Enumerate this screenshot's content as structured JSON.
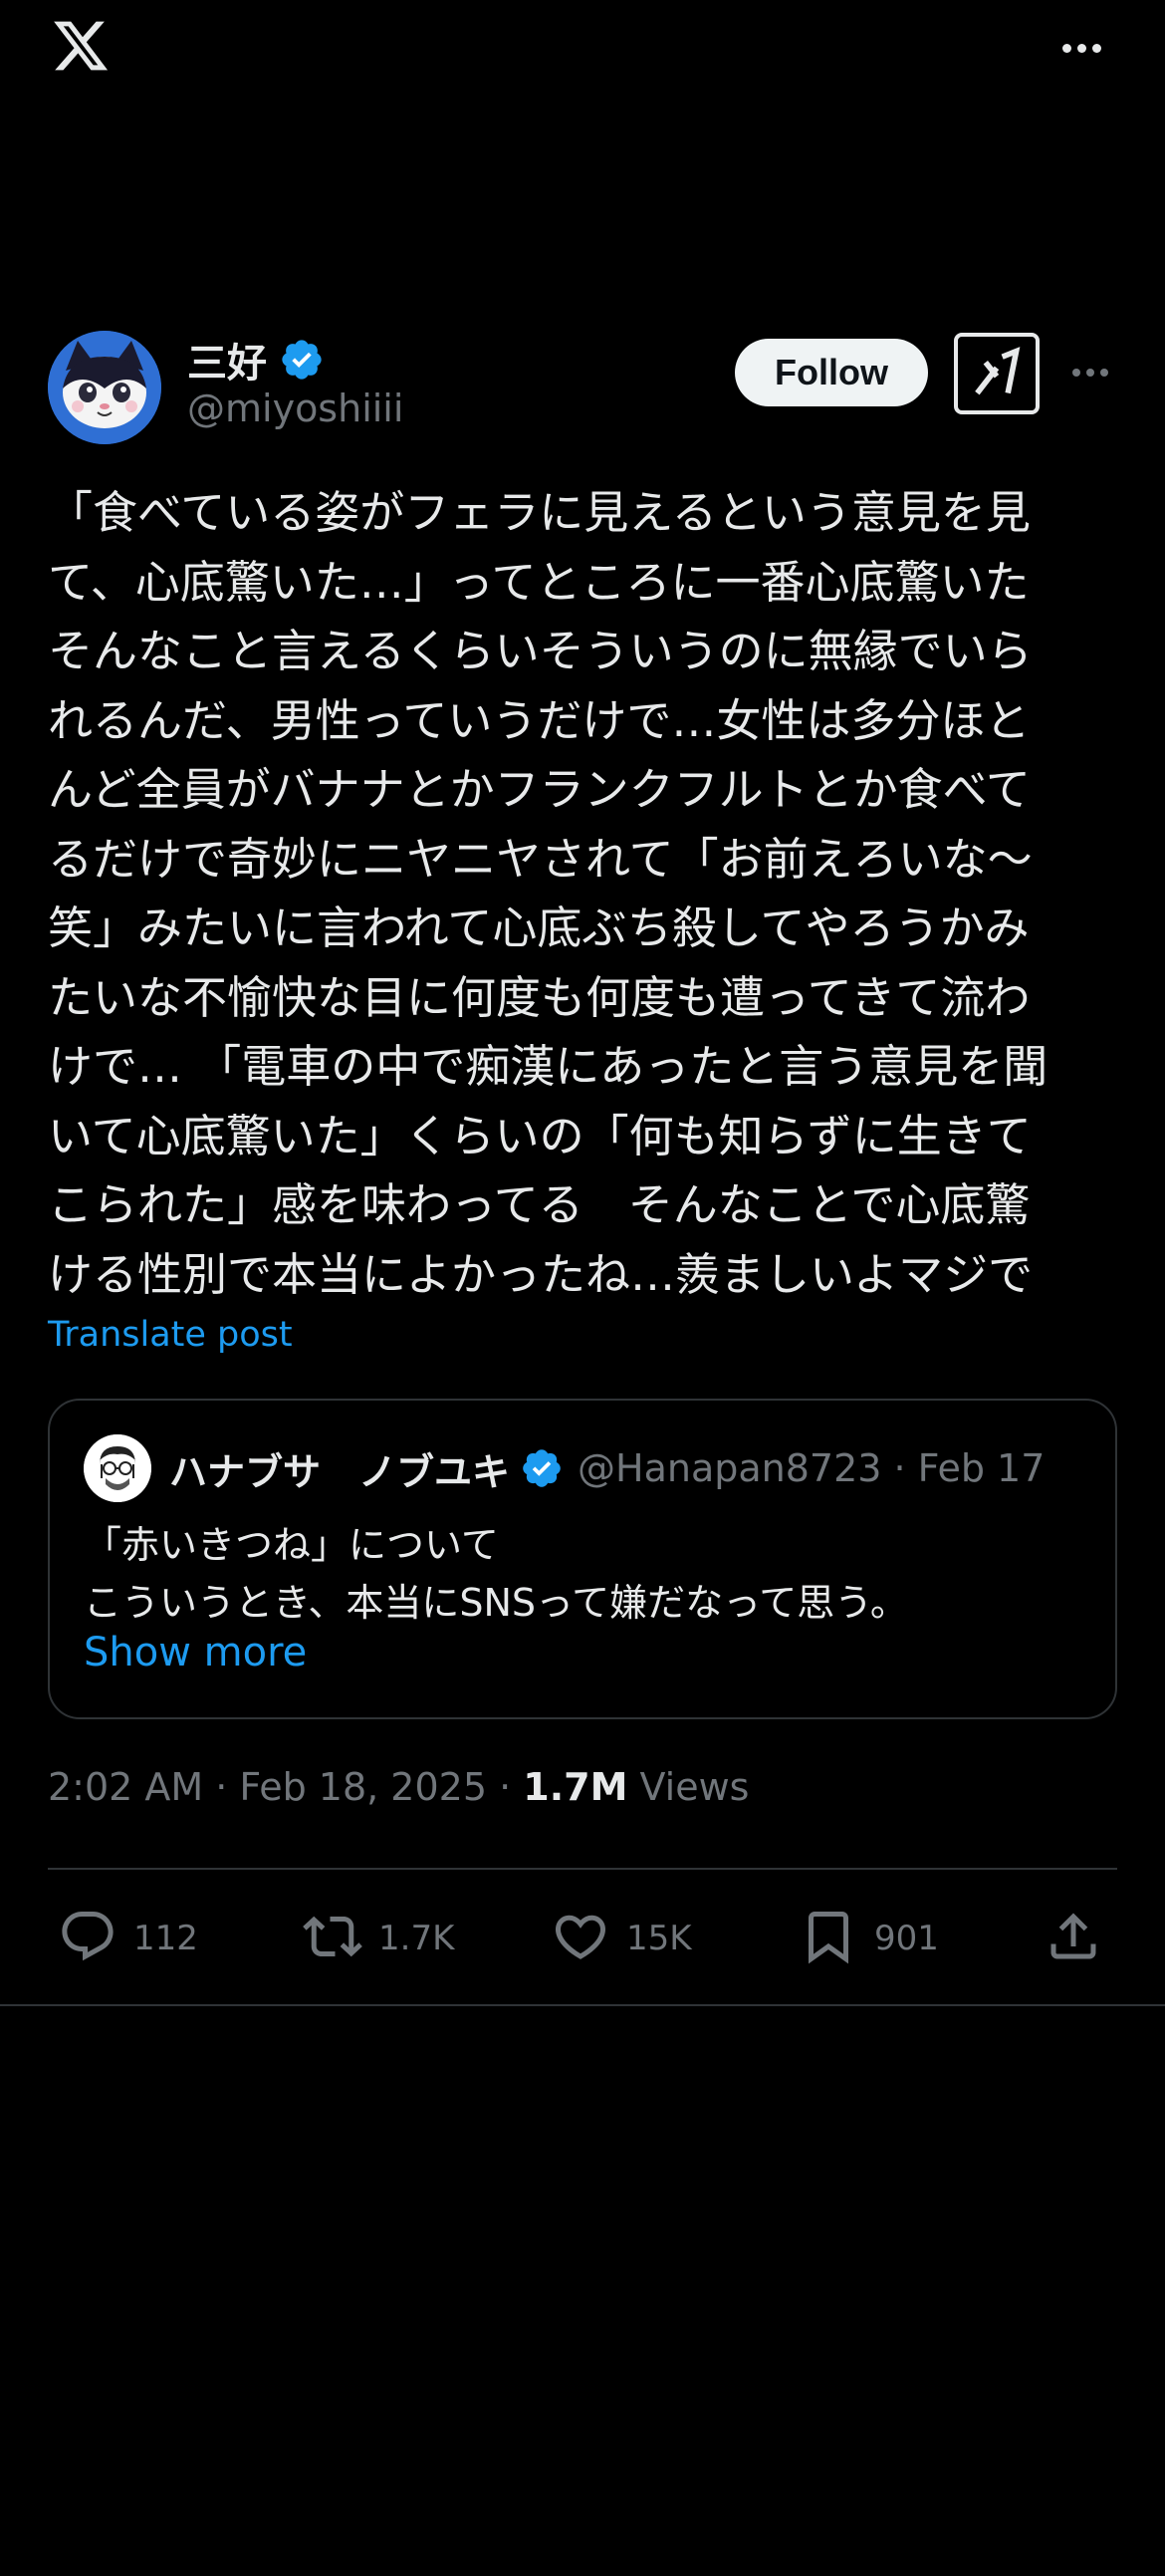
{
  "header": {
    "logo_icon": "x-logo-icon",
    "more_icon": "more-horizontal-icon"
  },
  "author": {
    "name": "三好",
    "handle": "@miyoshiiii",
    "verified": true,
    "follow_label": "Follow",
    "grok_icon": "grok-icon"
  },
  "post": {
    "text": "「食べている姿がフェラに見えるという意見を見\nて、心底驚いた…」ってところに一番心底驚いた\nそんなこと言えるくらいそういうのに無縁でいら\nれるんだ、男性っていうだけで…女性は多分ほと\nんど全員がバナナとかフランクフルトとか食べて\nるだけで奇妙にニヤニヤされて「お前えろいな〜\n笑」みたいに言われて心底ぶち殺してやろうかみ\nたいな不愉快な目に何度も何度も遭ってきて流わ\nけで… 「電車の中で痴漢にあったと言う意見を聞\nいて心底驚いた」くらいの「何も知らずに生きて\nこられた」感を味わってる　そんなことで心底驚\nける性別で本当によかったね…羨ましいよマジで",
    "translate_label": "Translate post"
  },
  "quote": {
    "name": "ハナブサ　ノブユキ",
    "handle_date": "@Hanapan8723 · Feb 17",
    "line1": "「赤いきつね」について",
    "line2": "こういうとき、本当にSNSって嫌だなって思う。",
    "show_more": "Show more"
  },
  "meta": {
    "time_date": "2:02 AM · Feb 18, 2025 · ",
    "views_count": "1.7M",
    "views_label": " Views"
  },
  "actions": {
    "replies": "112",
    "reposts": "1.7K",
    "likes": "15K",
    "bookmarks": "901"
  },
  "colors": {
    "background": "#000000",
    "text": "#e7e9ea",
    "secondary": "#71767b",
    "accent": "#1d9bf0",
    "border": "#2f3336"
  }
}
